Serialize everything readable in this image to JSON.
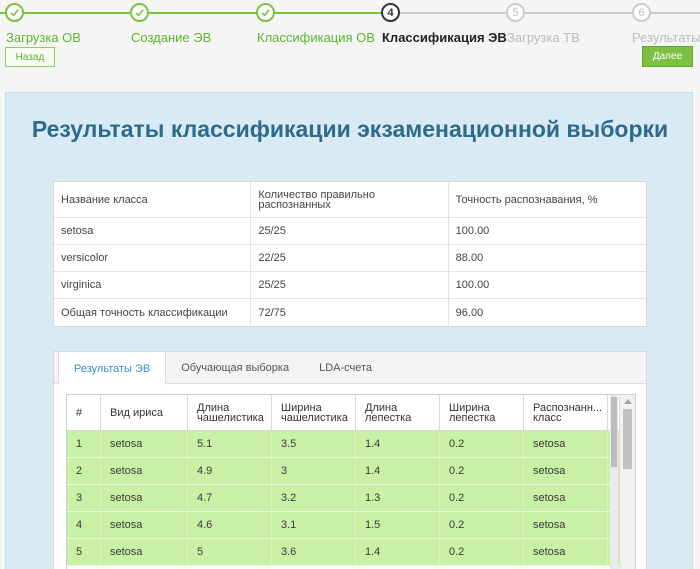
{
  "wizard": {
    "steps": [
      {
        "num": "1",
        "label": "Загрузка ОВ",
        "state": "done"
      },
      {
        "num": "2",
        "label": "Создание ЭВ",
        "state": "done"
      },
      {
        "num": "3",
        "label": "Классификация ОВ",
        "state": "done"
      },
      {
        "num": "4",
        "label": "Классификация ЭВ",
        "state": "current"
      },
      {
        "num": "5",
        "label": "Загрузка ТВ",
        "state": "future"
      },
      {
        "num": "6",
        "label": "Результаты",
        "state": "future"
      }
    ],
    "back_label": "Назад",
    "next_label": "Далее"
  },
  "colors": {
    "accent_green": "#7dc142",
    "title_blue": "#2e6a8a",
    "row_green": "#c8f1a5",
    "panel_blue": "#d8ebf5"
  },
  "page_title": "Результаты классификации экзаменационной выборки",
  "summary": {
    "headers": [
      "Название класса",
      "Количество правильно распознанных",
      "Точность распознавания, %"
    ],
    "rows": [
      [
        "setosa",
        "25/25",
        "100.00"
      ],
      [
        "versicolor",
        "22/25",
        "88.00"
      ],
      [
        "virginica",
        "25/25",
        "100.00"
      ],
      [
        "Общая точность классификации",
        "72/75",
        "96.00"
      ]
    ]
  },
  "tabs": [
    "Результаты ЭВ",
    "Обучающая выборка",
    "LDA-счета"
  ],
  "results_grid": {
    "headers": [
      "#",
      "Вид ириса",
      "Длина чашелистика",
      "Ширина чашелистика",
      "Длина лепестка",
      "Ширина лепестка",
      "Распознанн... класс"
    ],
    "rows": [
      [
        "1",
        "setosa",
        "5.1",
        "3.5",
        "1.4",
        "0.2",
        "setosa"
      ],
      [
        "2",
        "setosa",
        "4.9",
        "3",
        "1.4",
        "0.2",
        "setosa"
      ],
      [
        "3",
        "setosa",
        "4.7",
        "3.2",
        "1.3",
        "0.2",
        "setosa"
      ],
      [
        "4",
        "setosa",
        "4.6",
        "3.1",
        "1.5",
        "0.2",
        "setosa"
      ],
      [
        "5",
        "setosa",
        "5",
        "3.6",
        "1.4",
        "0.2",
        "setosa"
      ]
    ]
  }
}
